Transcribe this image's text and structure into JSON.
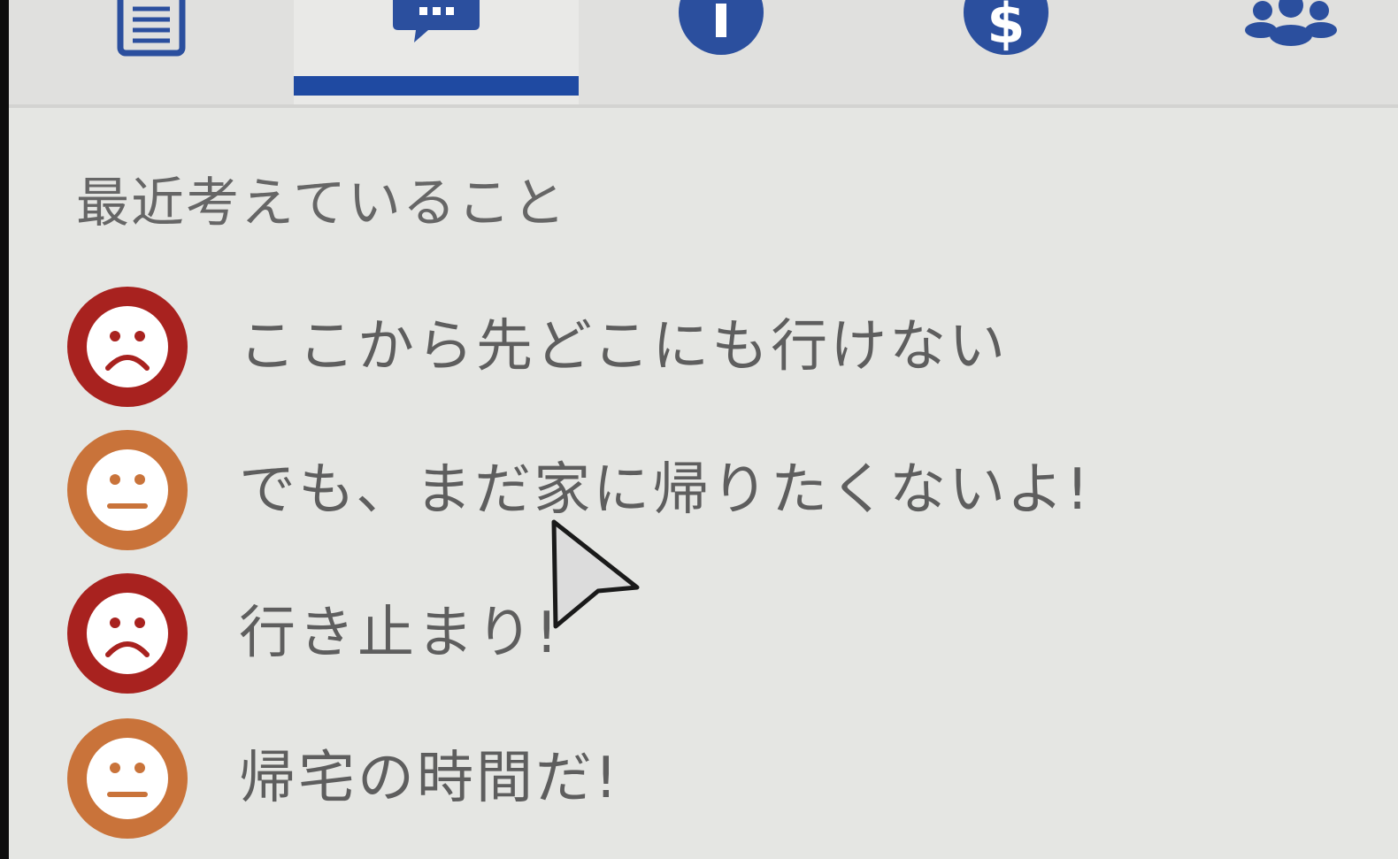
{
  "tabs": [
    {
      "icon": "document-icon",
      "active": false
    },
    {
      "icon": "chat-bubble-icon",
      "active": true
    },
    {
      "icon": "info-icon",
      "active": false
    },
    {
      "icon": "dollar-icon",
      "active": false
    },
    {
      "icon": "group-icon",
      "active": false
    }
  ],
  "colors": {
    "accent": "#1f4aa2",
    "sad_face": "#a8221f",
    "neutral_face": "#c9733a",
    "text": "#5e5e5e"
  },
  "section": {
    "title": "最近考えていること"
  },
  "thoughts": [
    {
      "mood_icon": "sad-face-icon",
      "text": "ここから先どこにも行けない"
    },
    {
      "mood_icon": "neutral-face-icon",
      "text": "でも、まだ家に帰りたくないよ!"
    },
    {
      "mood_icon": "sad-face-icon",
      "text": "行き止まり!"
    },
    {
      "mood_icon": "neutral-face-icon",
      "text": "帰宅の時間だ!"
    }
  ]
}
